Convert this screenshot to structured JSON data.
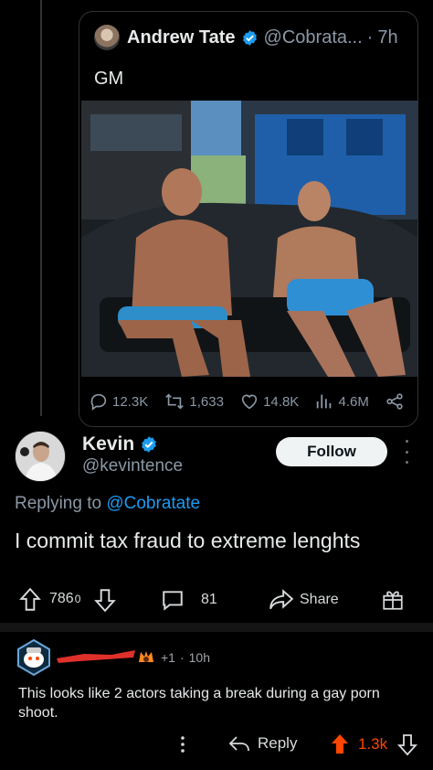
{
  "quote": {
    "name": "Andrew Tate",
    "handle": "@Cobrata...",
    "sep": "·",
    "time": "7h",
    "text": "GM"
  },
  "stats": {
    "replies": "12.3K",
    "retweets": "1,633",
    "likes": "14.8K",
    "views": "4.6M"
  },
  "reply": {
    "name": "Kevin",
    "handle": "@kevintence",
    "follow_label": "Follow",
    "replying_prefix": "Replying to",
    "replying_handle": "@Cobratate",
    "text": "I commit tax fraud to extreme lenghts"
  },
  "post_actions": {
    "votes": "786",
    "vote_superscript": "0",
    "comments": "81",
    "share_label": "Share"
  },
  "comment": {
    "award_count": "+1",
    "sep": "·",
    "time": "10h",
    "text": "This looks like 2 actors taking a break during a gay porn shoot.",
    "reply_label": "Reply",
    "votes": "1.3k"
  },
  "colors": {
    "verified_blue": "#1d9bf0",
    "upvote_orange": "#ff4500",
    "redaction_red": "#e0302a"
  },
  "icons": [
    "verified-icon",
    "reply-icon",
    "retweet-icon",
    "like-icon",
    "views-icon",
    "share-icon",
    "upvote-icon",
    "downvote-icon",
    "comment-icon",
    "gift-icon",
    "more-icon"
  ]
}
